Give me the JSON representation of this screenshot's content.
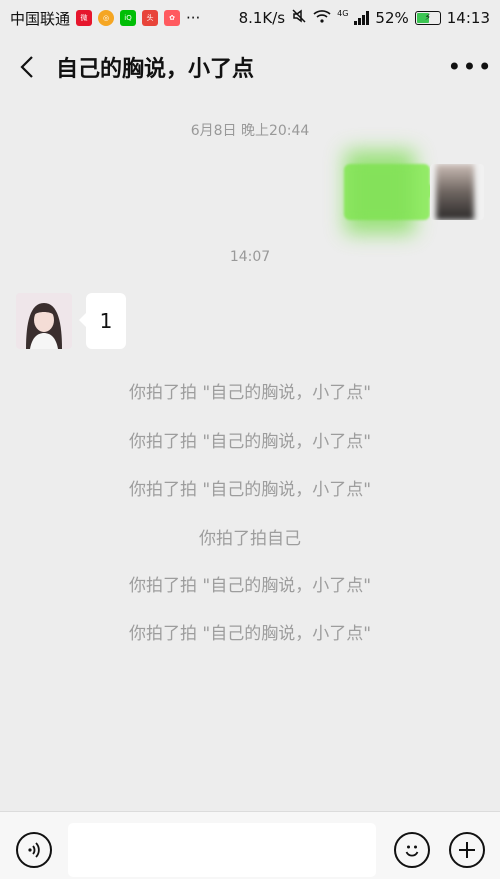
{
  "status_bar": {
    "carrier": "中国联通",
    "more_indicator": "···",
    "net_speed": "8.1K/s",
    "network_type": "4G",
    "battery_percent": "52%",
    "time": "14:13",
    "app_icons": [
      "weibo-icon",
      "camera-icon",
      "iqiyi-icon",
      "news-icon",
      "shopping-icon"
    ],
    "battery_level": 0.52
  },
  "header": {
    "title": "自己的胸说，小了点",
    "more_label": "•••"
  },
  "chat": {
    "timestamp_1": "6月8日 晚上20:44",
    "timestamp_2": "14:07",
    "received_message": "1",
    "system_messages": [
      "你拍了拍 \"自己的胸说，小了点\"",
      "你拍了拍 \"自己的胸说，小了点\"",
      "你拍了拍 \"自己的胸说，小了点\"",
      "你拍了拍自己",
      "你拍了拍 \"自己的胸说，小了点\"",
      "你拍了拍 \"自己的胸说，小了点\""
    ]
  },
  "input_bar": {
    "value": "",
    "placeholder": ""
  },
  "colors": {
    "background": "#ededed",
    "sent_bubble": "#95ec69",
    "received_bubble": "#ffffff",
    "system_text": "#9d9d9d"
  }
}
